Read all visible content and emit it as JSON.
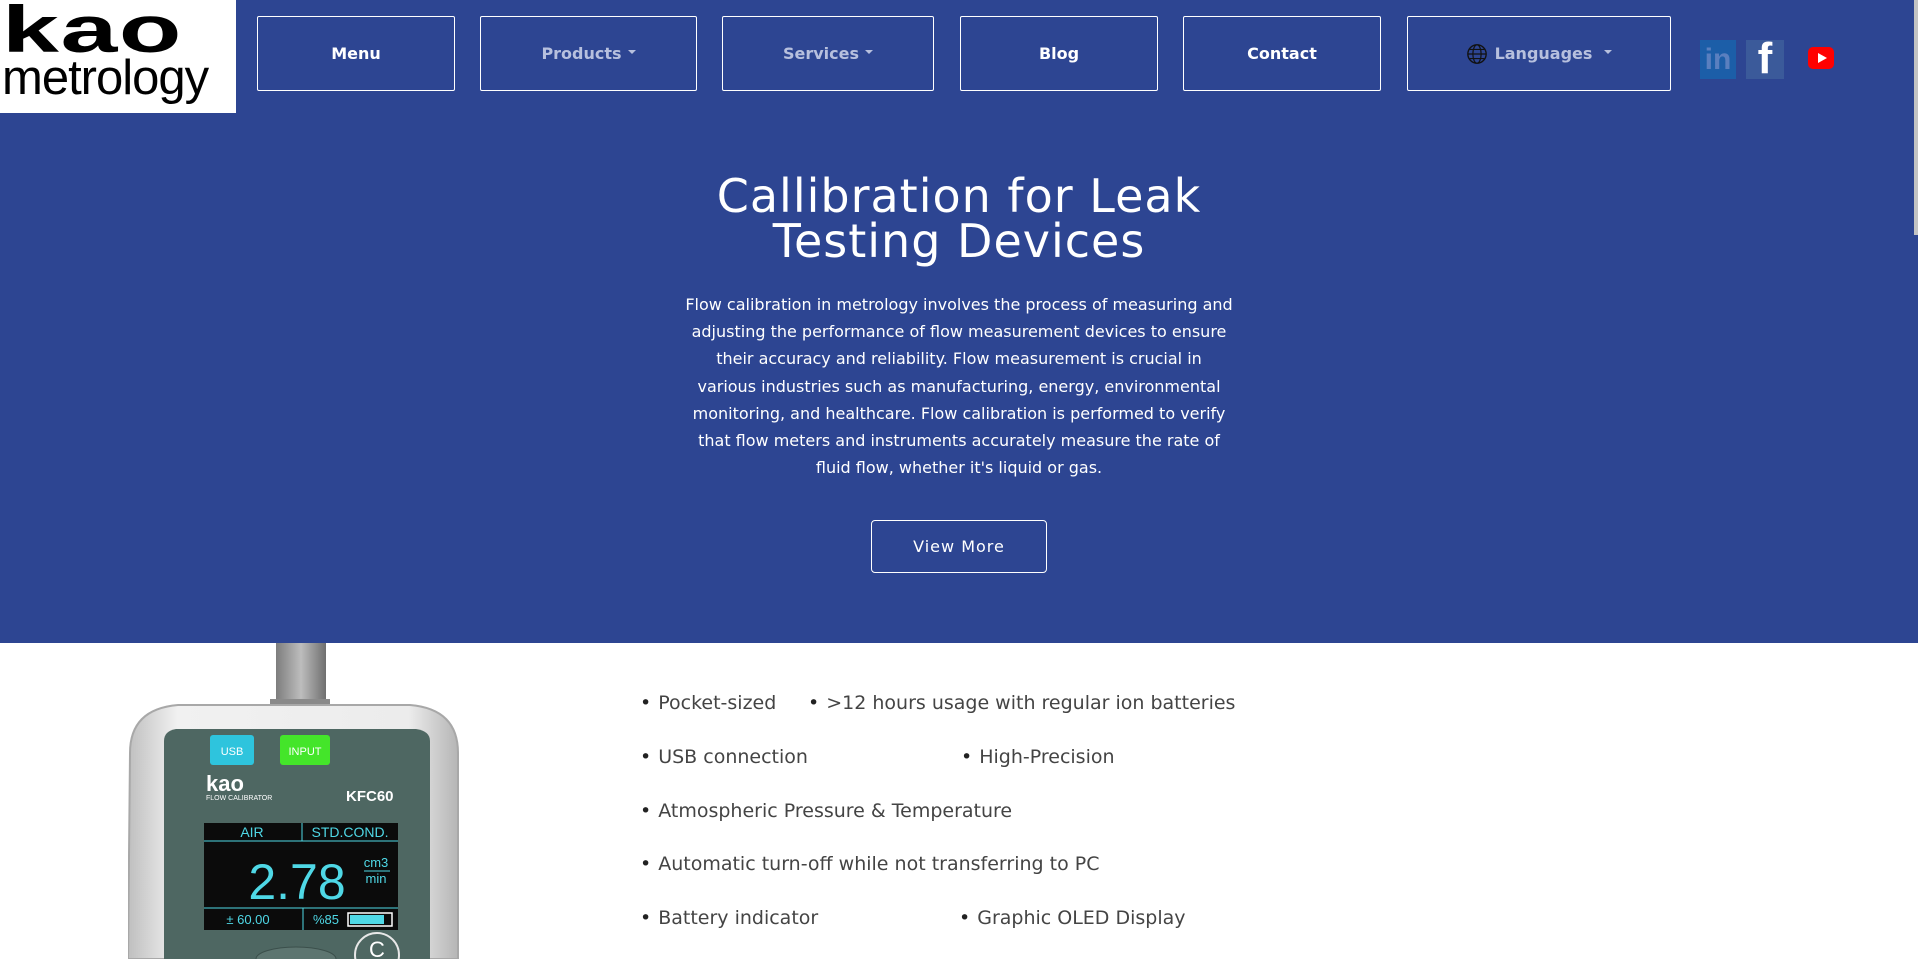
{
  "header": {
    "logo": {
      "line1": "kao",
      "line2": "metrology"
    },
    "nav": [
      {
        "label": "Menu",
        "dropdown": false
      },
      {
        "label": "Products",
        "dropdown": true
      },
      {
        "label": "Services",
        "dropdown": true
      },
      {
        "label": "Blog",
        "dropdown": false
      },
      {
        "label": "Contact",
        "dropdown": false
      },
      {
        "label": "Languages",
        "dropdown": true,
        "icon": "globe-icon"
      }
    ],
    "social": [
      {
        "name": "linkedin-icon",
        "glyph": "in"
      },
      {
        "name": "facebook-icon",
        "glyph": "f"
      },
      {
        "name": "youtube-icon"
      }
    ],
    "colors": {
      "primary": "#2d4592",
      "text": "#ffffff",
      "muted_nav": "#b7c0de"
    }
  },
  "hero": {
    "title_line1": "Callibration for Leak",
    "title_line2": "Testing Devices",
    "text_lines": [
      "Flow calibration in metrology involves the process of measuring and",
      "adjusting the performance of flow measurement devices to ensure",
      "their accuracy and reliability. Flow measurement is crucial in",
      "various industries such as manufacturing, energy, environmental",
      "monitoring, and healthcare. Flow calibration is performed to verify",
      "that flow meters and instruments accurately measure the rate of",
      "fluid flow, whether it's liquid or gas."
    ],
    "button": "View More"
  },
  "device": {
    "usb_label": "USB",
    "input_label": "INPUT",
    "brand": "kao",
    "brand_sub": "FLOW CALIBRATOR",
    "model": "KFC60",
    "gas": "AIR",
    "condition": "STD.COND.",
    "reading": "2.78",
    "unit_top": "cm3",
    "unit_bottom": "min",
    "range": "± 60.00",
    "percent": "%85",
    "key_glyph": "C"
  },
  "features": [
    {
      "text": "Pocket-sized"
    },
    {
      "text": ">12 hours usage with regular ion batteries"
    },
    {
      "text": "USB connection"
    },
    {
      "text": "High-Precision"
    },
    {
      "text": "Atmospheric Pressure & Temperature"
    },
    {
      "text": "Automatic turn-off while not transferring to PC"
    },
    {
      "text": "Battery indicator"
    },
    {
      "text": "Graphic OLED Display"
    }
  ]
}
